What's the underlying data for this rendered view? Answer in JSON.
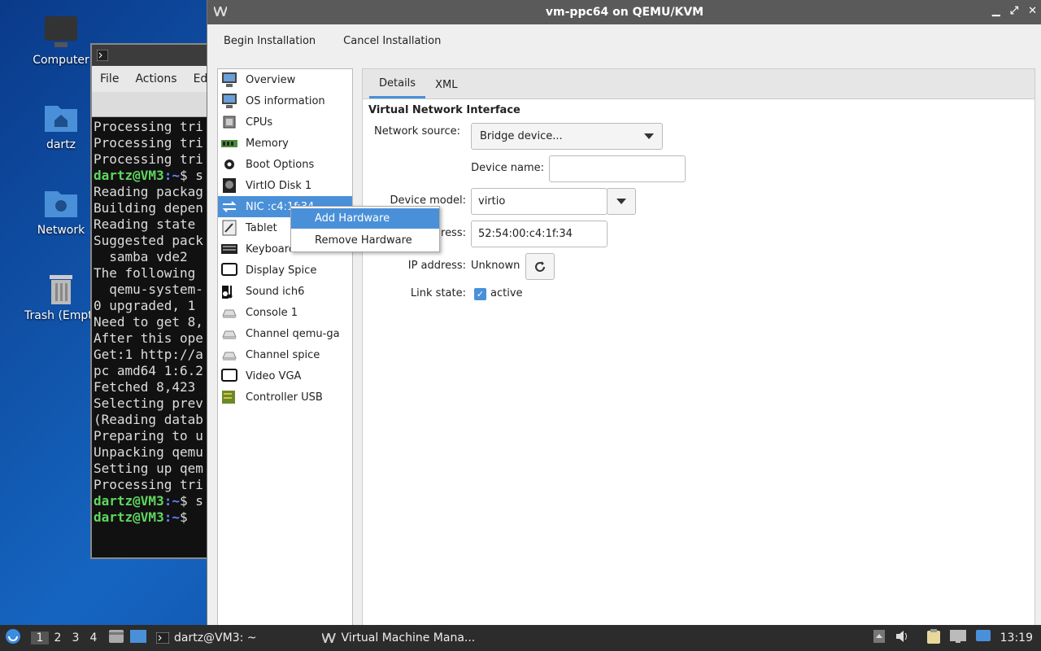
{
  "desktop": {
    "icons": [
      {
        "label": "Computer"
      },
      {
        "label": "dartz"
      },
      {
        "label": "Network"
      },
      {
        "label": "Trash (Empty)"
      }
    ]
  },
  "terminal": {
    "menu": [
      "File",
      "Actions",
      "Ed"
    ],
    "lines": [
      {
        "type": "text",
        "text": "Processing tri"
      },
      {
        "type": "text",
        "text": "Processing tri"
      },
      {
        "type": "text",
        "text": "Processing tri"
      },
      {
        "type": "prompt",
        "user": "dartz@VM3",
        "path": ":~",
        "rest": "$ s"
      },
      {
        "type": "text",
        "text": "Reading packag"
      },
      {
        "type": "text",
        "text": "Building depen"
      },
      {
        "type": "text",
        "text": "Reading state "
      },
      {
        "type": "text",
        "text": "Suggested pack"
      },
      {
        "type": "text",
        "text": "  samba vde2"
      },
      {
        "type": "text",
        "text": "The following "
      },
      {
        "type": "text",
        "text": "  qemu-system-"
      },
      {
        "type": "text",
        "text": "0 upgraded, 1 "
      },
      {
        "type": "text",
        "text": "Need to get 8,"
      },
      {
        "type": "text",
        "text": "After this ope"
      },
      {
        "type": "text",
        "text": "Get:1 http://a"
      },
      {
        "type": "text",
        "text": "pc amd64 1:6.2"
      },
      {
        "type": "text",
        "text": "Fetched 8,423 "
      },
      {
        "type": "text",
        "text": "Selecting prev"
      },
      {
        "type": "text",
        "text": "(Reading datab"
      },
      {
        "type": "text",
        "text": "Preparing to u"
      },
      {
        "type": "text",
        "text": "Unpacking qemu"
      },
      {
        "type": "text",
        "text": "Setting up qem"
      },
      {
        "type": "text",
        "text": "Processing tri"
      },
      {
        "type": "prompt",
        "user": "dartz@VM3",
        "path": ":~",
        "rest": "$ s"
      },
      {
        "type": "prompt",
        "user": "dartz@VM3",
        "path": ":~",
        "rest": "$ "
      }
    ]
  },
  "vm": {
    "title": "vm-ppc64 on QEMU/KVM",
    "toolbar": {
      "begin": "Begin Installation",
      "cancel": "Cancel Installation"
    },
    "hardware": [
      {
        "label": "Overview",
        "icon": "monitor-icon"
      },
      {
        "label": "OS information",
        "icon": "monitor-icon"
      },
      {
        "label": "CPUs",
        "icon": "cpu-icon"
      },
      {
        "label": "Memory",
        "icon": "memory-icon"
      },
      {
        "label": "Boot Options",
        "icon": "gear-icon"
      },
      {
        "label": "VirtIO Disk 1",
        "icon": "disk-icon"
      },
      {
        "label": "NIC :c4:1f:34",
        "icon": "network-arrows-icon",
        "selected": true
      },
      {
        "label": "Tablet",
        "icon": "tablet-icon"
      },
      {
        "label": "Keyboard",
        "icon": "keyboard-icon"
      },
      {
        "label": "Display Spice",
        "icon": "display-icon"
      },
      {
        "label": "Sound ich6",
        "icon": "sound-icon"
      },
      {
        "label": "Console 1",
        "icon": "serial-icon"
      },
      {
        "label": "Channel qemu-ga",
        "icon": "serial-icon"
      },
      {
        "label": "Channel spice",
        "icon": "serial-icon"
      },
      {
        "label": "Video VGA",
        "icon": "display-icon"
      },
      {
        "label": "Controller USB",
        "icon": "controller-icon"
      }
    ],
    "tabs": [
      "Details",
      "XML"
    ],
    "section_title": "Virtual Network Interface",
    "fields": {
      "network_source_label": "Network source:",
      "network_source_value": "Bridge device...",
      "device_name_label": "Device name:",
      "device_name_value": "",
      "device_model_label": "Device model:",
      "device_model_value": "virtio",
      "mac_label": "ddress:",
      "mac_value": "52:54:00:c4:1f:34",
      "ip_label": "IP address:",
      "ip_value": "Unknown",
      "link_label": "Link state:",
      "link_value": "active"
    }
  },
  "context_menu": {
    "items": [
      "Add Hardware",
      "Remove Hardware"
    ]
  },
  "taskbar": {
    "workspaces": [
      "1",
      "2",
      "3",
      "4"
    ],
    "tasks": [
      "dartz@VM3: ~",
      "Virtual Machine Mana..."
    ],
    "clock": "13:19"
  }
}
